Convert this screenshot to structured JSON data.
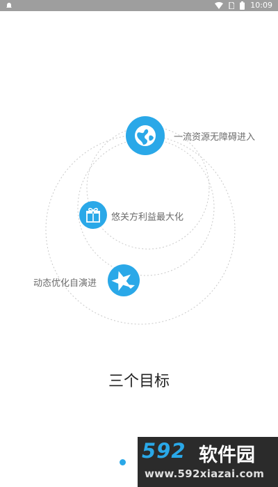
{
  "status_bar": {
    "time": "10:09",
    "icons": [
      "notification-icon",
      "wifi-icon",
      "sim-icon",
      "battery-icon"
    ]
  },
  "goals": [
    {
      "label": "一流资源无障碍进入",
      "icon": "globe-icon"
    },
    {
      "label": "悠关方利益最大化",
      "icon": "gift-icon"
    },
    {
      "label": "动态优化自演进",
      "icon": "star-icon"
    }
  ],
  "title": "三个目标",
  "pager": {
    "total": 1,
    "current": 1
  },
  "watermark": {
    "logo": "592",
    "brand": "软件园",
    "url": "www.592xiazai.com"
  },
  "colors": {
    "accent": "#2aa8e8",
    "status_bar": "#9e9e9e",
    "label_text": "#6b6b6b"
  }
}
